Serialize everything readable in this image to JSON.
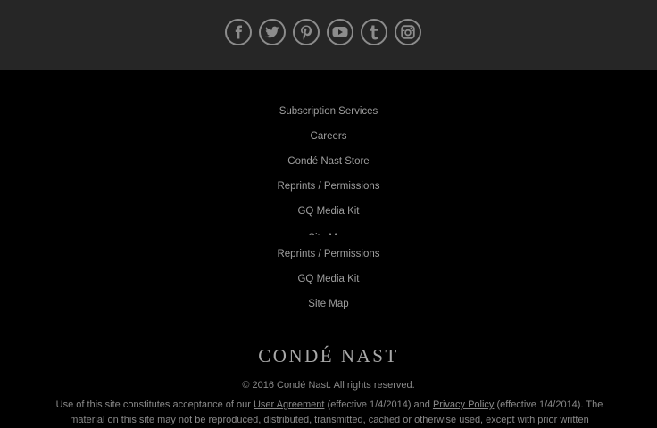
{
  "social": {
    "icons": [
      "facebook-icon",
      "twitter-icon",
      "pinterest-icon",
      "youtube-icon",
      "tumblr-icon",
      "instagram-icon"
    ],
    "icon_color": "#8c8c8c",
    "bar_color": "#262626"
  },
  "footer": {
    "links": [
      "Subscription Services",
      "Careers",
      "Condé Nast Store",
      "Reprints / Permissions",
      "GQ Media Kit",
      "Site Map",
      "Reprints / Permissions",
      "GQ Media Kit",
      "Site Map"
    ],
    "logo": "CONDÉ NAST",
    "copyright": "© 2016 Condé Nast. All rights reserved.",
    "legal": {
      "part1": "Use of this site constitutes acceptance of our ",
      "user_agreement": "User Agreement",
      "part2": " (effective 1/4/2014) and ",
      "privacy_policy": "Privacy Policy",
      "part3": " (effective 1/4/2014). The material on this site may not be reproduced, distributed, transmitted, cached or otherwise used, except with prior written"
    }
  }
}
